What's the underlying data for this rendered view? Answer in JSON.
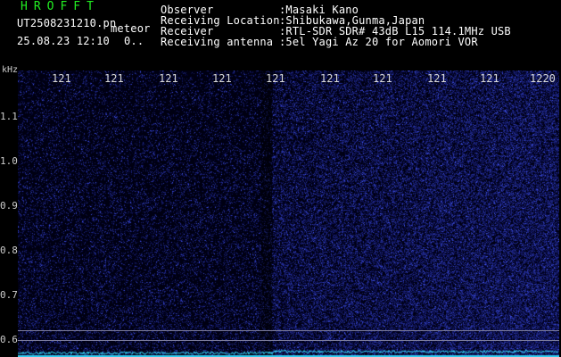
{
  "header": {
    "app_title": "HROFFT",
    "filename": "UT2508231210.pn",
    "meteor_tag": "meteor",
    "datetime": "25.08.23 12:10",
    "status": "0..",
    "info": [
      {
        "label": "Observer",
        "value": ":Masaki Kano"
      },
      {
        "label": "Receiving Location",
        "value": ":Shibukawa,Gunma,Japan"
      },
      {
        "label": "Receiver",
        "value": ":RTL-SDR SDR# 43dB L15 114.1MHz USB"
      },
      {
        "label": "Receiving antenna",
        "value": ":5el Yagi Az 20 for Aomori VOR"
      }
    ]
  },
  "axes": {
    "y_unit": "kHz",
    "y_ticks": [
      "1.1",
      "1.0",
      "0.9",
      "0.8",
      "0.7",
      "0.6"
    ],
    "x_ticks": [
      "121",
      "121",
      "121",
      "121",
      "121",
      "121",
      "121",
      "121",
      "121",
      "1220"
    ]
  },
  "colors": {
    "background": "#000000",
    "title": "#22ee22",
    "spectrum": "#3344ff",
    "baseline": "#33ddff"
  }
}
